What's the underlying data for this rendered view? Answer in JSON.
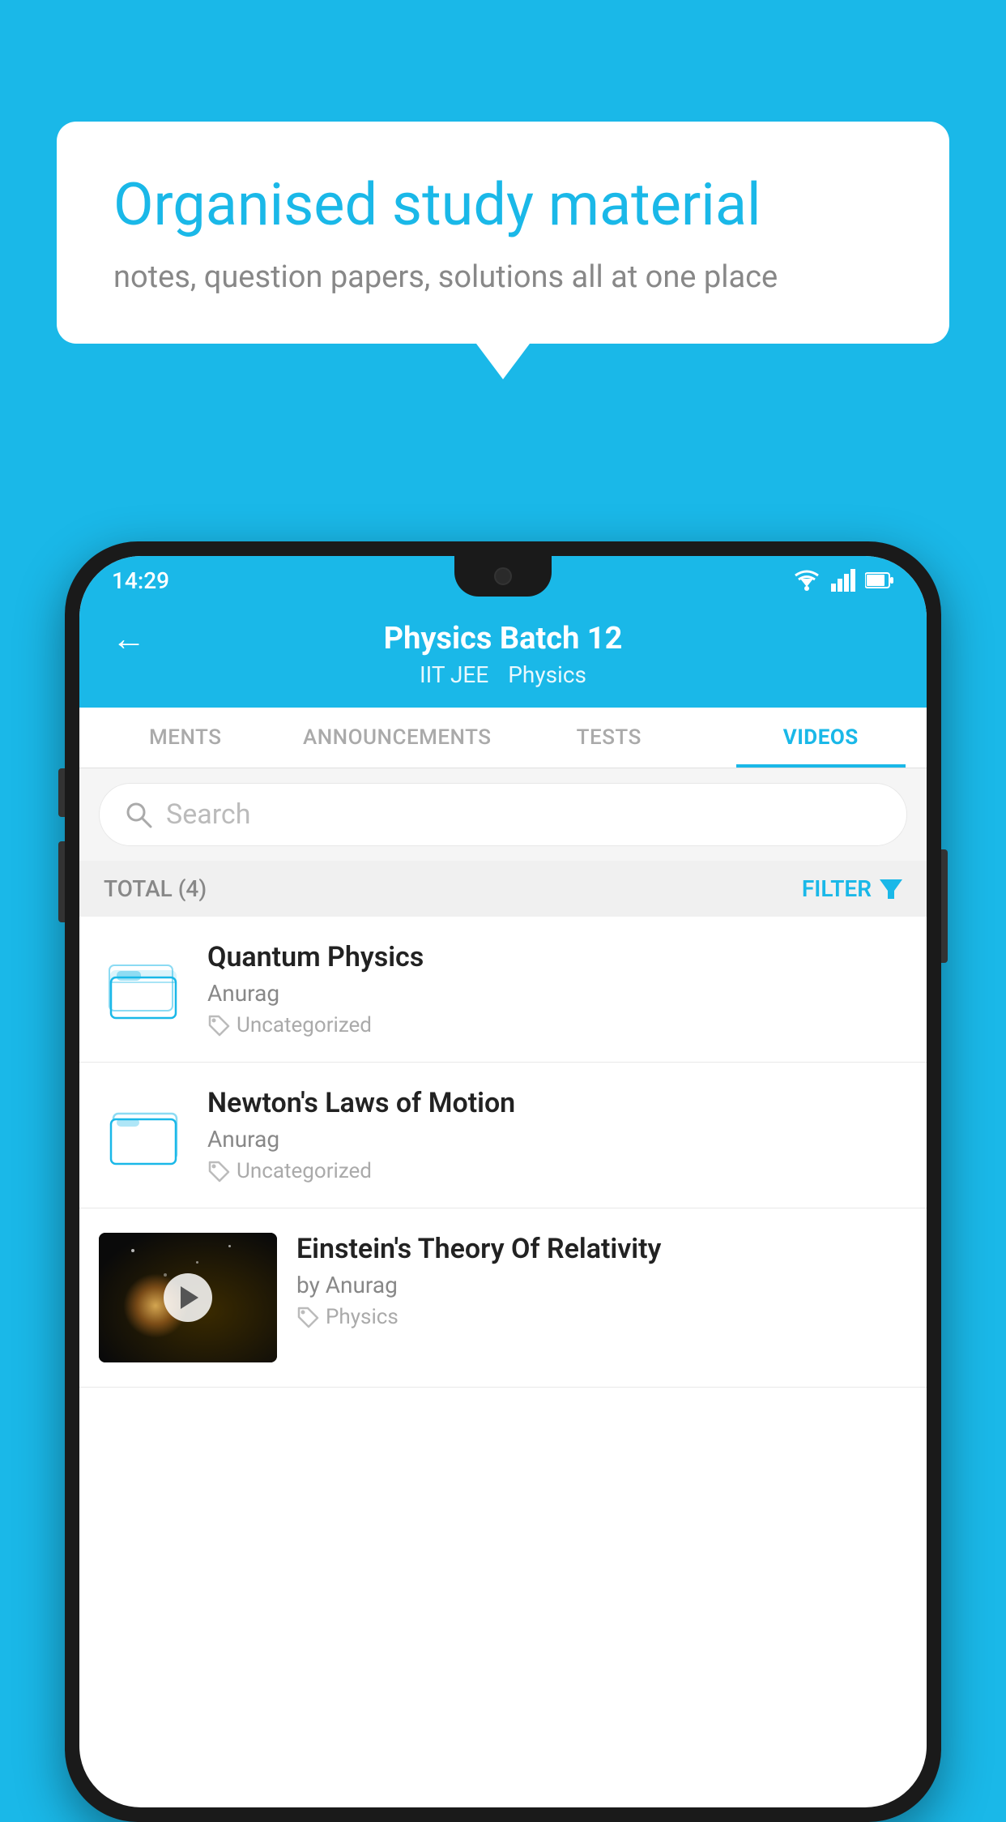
{
  "background_color": "#1ab8e8",
  "bubble": {
    "headline": "Organised study material",
    "subtext": "notes, question papers, solutions all at one place"
  },
  "phone": {
    "status_bar": {
      "time": "14:29",
      "icons": [
        "wifi",
        "signal",
        "battery"
      ]
    },
    "header": {
      "back_label": "←",
      "title": "Physics Batch 12",
      "subtitle_tags": [
        "IIT JEE",
        "Physics"
      ]
    },
    "tabs": [
      {
        "label": "MENTS",
        "active": false
      },
      {
        "label": "ANNOUNCEMENTS",
        "active": false
      },
      {
        "label": "TESTS",
        "active": false
      },
      {
        "label": "VIDEOS",
        "active": true
      }
    ],
    "search": {
      "placeholder": "Search"
    },
    "filter_bar": {
      "total_label": "TOTAL (4)",
      "filter_label": "FILTER"
    },
    "videos": [
      {
        "title": "Quantum Physics",
        "author": "Anurag",
        "tag": "Uncategorized",
        "has_thumbnail": false
      },
      {
        "title": "Newton's Laws of Motion",
        "author": "Anurag",
        "tag": "Uncategorized",
        "has_thumbnail": false
      },
      {
        "title": "Einstein's Theory Of Relativity",
        "author": "by Anurag",
        "tag": "Physics",
        "has_thumbnail": true
      }
    ]
  }
}
